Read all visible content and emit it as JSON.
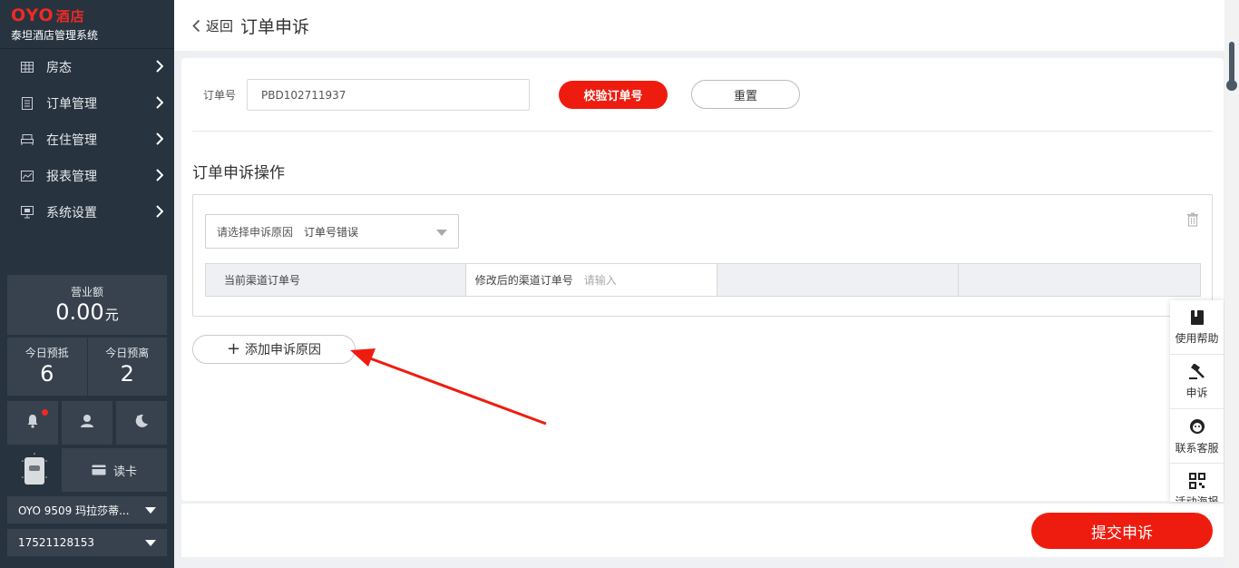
{
  "sidebar": {
    "brand_logo": "OYO",
    "brand_hotel": "酒店",
    "brand_sub": "泰坦酒店管理系统",
    "menu": [
      {
        "label": "房态",
        "icon": "grid-icon"
      },
      {
        "label": "订单管理",
        "icon": "document-icon"
      },
      {
        "label": "在住管理",
        "icon": "bed-icon"
      },
      {
        "label": "报表管理",
        "icon": "chart-icon"
      },
      {
        "label": "系统设置",
        "icon": "monitor-icon"
      }
    ],
    "revenue_label": "营业额",
    "revenue_value": "0.00",
    "revenue_unit": "元",
    "arrivals_label": "今日预抵",
    "arrivals_value": "6",
    "departures_label": "今日预离",
    "departures_value": "2",
    "card_reader_label": "读卡",
    "hotel_select": "OYO 9509 玛拉莎蒂...",
    "phone_select": "17521128153"
  },
  "header": {
    "back_label": "返回",
    "title": "订单申诉"
  },
  "form": {
    "order_label": "订单号",
    "order_value": "PBD102711937",
    "verify_label": "校验订单号",
    "reset_label": "重置",
    "section_title": "订单申诉操作",
    "reason_placeholder": "请选择申诉原因",
    "reason_value": "订单号错误",
    "current_channel_label": "当前渠道订单号",
    "modified_channel_label": "修改后的渠道订单号",
    "modified_placeholder": "请输入",
    "add_reason_label": "添加申诉原因",
    "submit_label": "提交申诉"
  },
  "float_toolbar": [
    {
      "label": "使用帮助",
      "icon": "book-icon"
    },
    {
      "label": "申诉",
      "icon": "gavel-icon"
    },
    {
      "label": "联系客服",
      "icon": "headset-icon"
    },
    {
      "label": "活动海报",
      "icon": "qrcode-icon"
    }
  ],
  "colors": {
    "brand_red": "#ee1c0f",
    "sidebar_bg": "#27333f",
    "sidebar_panel": "#37424e"
  }
}
